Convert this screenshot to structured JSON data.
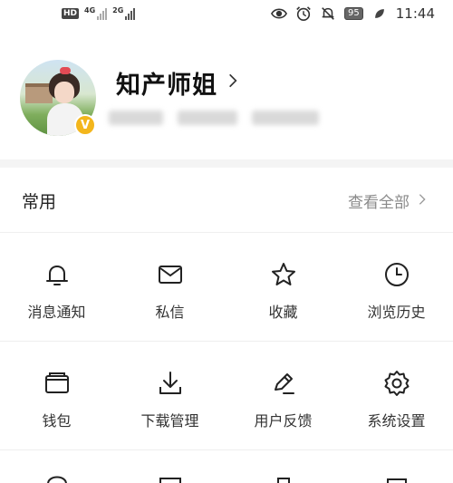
{
  "status_bar": {
    "hd": "HD",
    "sim1_network": "4G",
    "sim2_network": "2G",
    "battery": "95",
    "time": "11:44",
    "icons": [
      "eye-icon",
      "alarm-icon",
      "mute-bell-icon",
      "leaf-icon"
    ]
  },
  "profile": {
    "name": "知产师姐",
    "badge": "V"
  },
  "common": {
    "title": "常用",
    "see_all": "查看全部"
  },
  "grid": {
    "row1": [
      {
        "label": "消息通知",
        "icon": "bell-icon"
      },
      {
        "label": "私信",
        "icon": "mail-icon"
      },
      {
        "label": "收藏",
        "icon": "star-icon"
      },
      {
        "label": "浏览历史",
        "icon": "clock-icon"
      }
    ],
    "row2": [
      {
        "label": "钱包",
        "icon": "wallet-icon"
      },
      {
        "label": "下载管理",
        "icon": "download-icon"
      },
      {
        "label": "用户反馈",
        "icon": "pen-icon"
      },
      {
        "label": "系统设置",
        "icon": "gear-icon"
      }
    ]
  }
}
